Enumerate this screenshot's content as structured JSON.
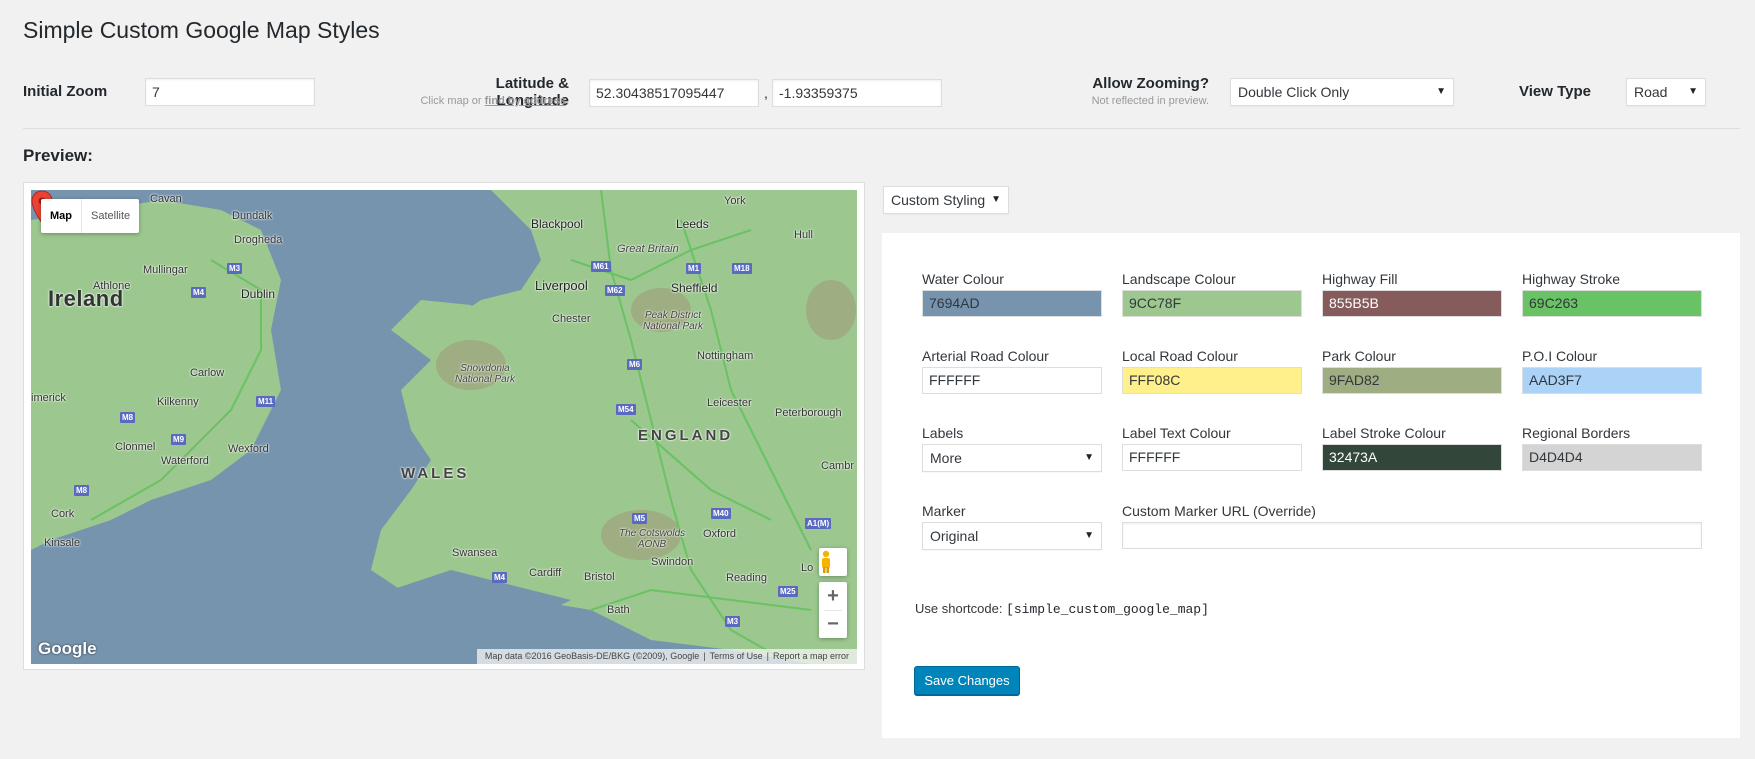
{
  "page_title": "Simple Custom Google Map Styles",
  "settings": {
    "initial_zoom_label": "Initial Zoom",
    "initial_zoom_value": "7",
    "latlng_label": "Latitude & Longitude",
    "latlng_hint_prefix": "Click map or",
    "latlng_hint_link": "find by address",
    "latlng_hint_suffix": ".",
    "latitude": "52.30438517095447",
    "longitude": "-1.93359375",
    "latlng_separator": ",",
    "allow_zooming_label": "Allow Zooming?",
    "allow_zooming_hint": "Not reflected in preview.",
    "allow_zooming_value": "Double Click Only",
    "view_type_label": "View Type",
    "view_type_value": "Road"
  },
  "preview_label": "Preview:",
  "map": {
    "type_map": "Map",
    "type_satellite": "Satellite",
    "logo": "Google",
    "attribution": "Map data ©2016 GeoBasis-DE/BKG (©2009), Google",
    "terms": "Terms of Use",
    "report": "Report a map error",
    "zoom_in": "+",
    "zoom_out": "−",
    "labels": {
      "ireland": "Ireland",
      "wales": "WALES",
      "england": "ENGLAND",
      "dublin": "Dublin",
      "cavan": "Cavan",
      "dundalk": "Dundalk",
      "drogheda": "Drogheda",
      "mullingar": "Mullingar",
      "athlone": "Athlone",
      "carlow": "Carlow",
      "kilkenny": "Kilkenny",
      "limerick": "imerick",
      "clonmel": "Clonmel",
      "waterford": "Waterford",
      "wexford": "Wexford",
      "cork": "Cork",
      "kinsale": "Kinsale",
      "blackpool": "Blackpool",
      "leeds": "Leeds",
      "york": "York",
      "hull": "Hull",
      "great_britain": "Great Britain",
      "liverpool": "Liverpool",
      "sheffield": "Sheffield",
      "chester": "Chester",
      "peak_district": "Peak District\nNational Park",
      "snowdonia": "Snowdonia\nNational Park",
      "nottingham": "Nottingham",
      "leicester": "Leicester",
      "peterborough": "Peterborough",
      "cambridge": "Cambr",
      "cotswolds": "The Cotswolds\nAONB",
      "oxford": "Oxford",
      "swansea": "Swansea",
      "cardiff": "Cardiff",
      "bristol": "Bristol",
      "swindon": "Swindon",
      "reading": "Reading",
      "bath": "Bath",
      "london": "Lo"
    },
    "shields": [
      "M3",
      "M4",
      "M11",
      "M8",
      "M9",
      "M8",
      "M61",
      "M62",
      "M1",
      "M18",
      "M6",
      "M54",
      "M5",
      "M40",
      "A1(M)",
      "M4",
      "M25",
      "M3"
    ]
  },
  "styling_mode": "Custom Styling",
  "fields": {
    "water": {
      "label": "Water Colour",
      "value": "7694AD",
      "color": "#7694AD"
    },
    "landscape": {
      "label": "Landscape Colour",
      "value": "9CC78F",
      "color": "#9CC78F"
    },
    "highway_fill": {
      "label": "Highway Fill",
      "value": "855B5B",
      "color": "#855B5B"
    },
    "highway_stroke": {
      "label": "Highway Stroke",
      "value": "69C263",
      "color": "#69C263"
    },
    "arterial": {
      "label": "Arterial Road Colour",
      "value": "FFFFFF",
      "color": "#FFFFFF"
    },
    "local_road": {
      "label": "Local Road Colour",
      "value": "FFF08C",
      "color": "#FFF08C"
    },
    "park": {
      "label": "Park Colour",
      "value": "9FAD82",
      "color": "#9FAD82"
    },
    "poi": {
      "label": "P.O.I Colour",
      "value": "AAD3F7",
      "color": "#AAD3F7"
    },
    "labels": {
      "label": "Labels",
      "value": "More"
    },
    "label_text": {
      "label": "Label Text Colour",
      "value": "FFFFFF",
      "color": "#FFFFFF"
    },
    "label_stroke": {
      "label": "Label Stroke Colour",
      "value": "32473A",
      "color": "#32473A"
    },
    "regional_borders": {
      "label": "Regional Borders",
      "value": "D4D4D4",
      "color": "#D4D4D4"
    },
    "marker": {
      "label": "Marker",
      "value": "Original"
    },
    "custom_marker_url": {
      "label": "Custom Marker URL (Override)",
      "value": ""
    }
  },
  "shortcode_label": "Use shortcode:",
  "shortcode": "[simple_custom_google_map]",
  "save_button": "Save Changes"
}
